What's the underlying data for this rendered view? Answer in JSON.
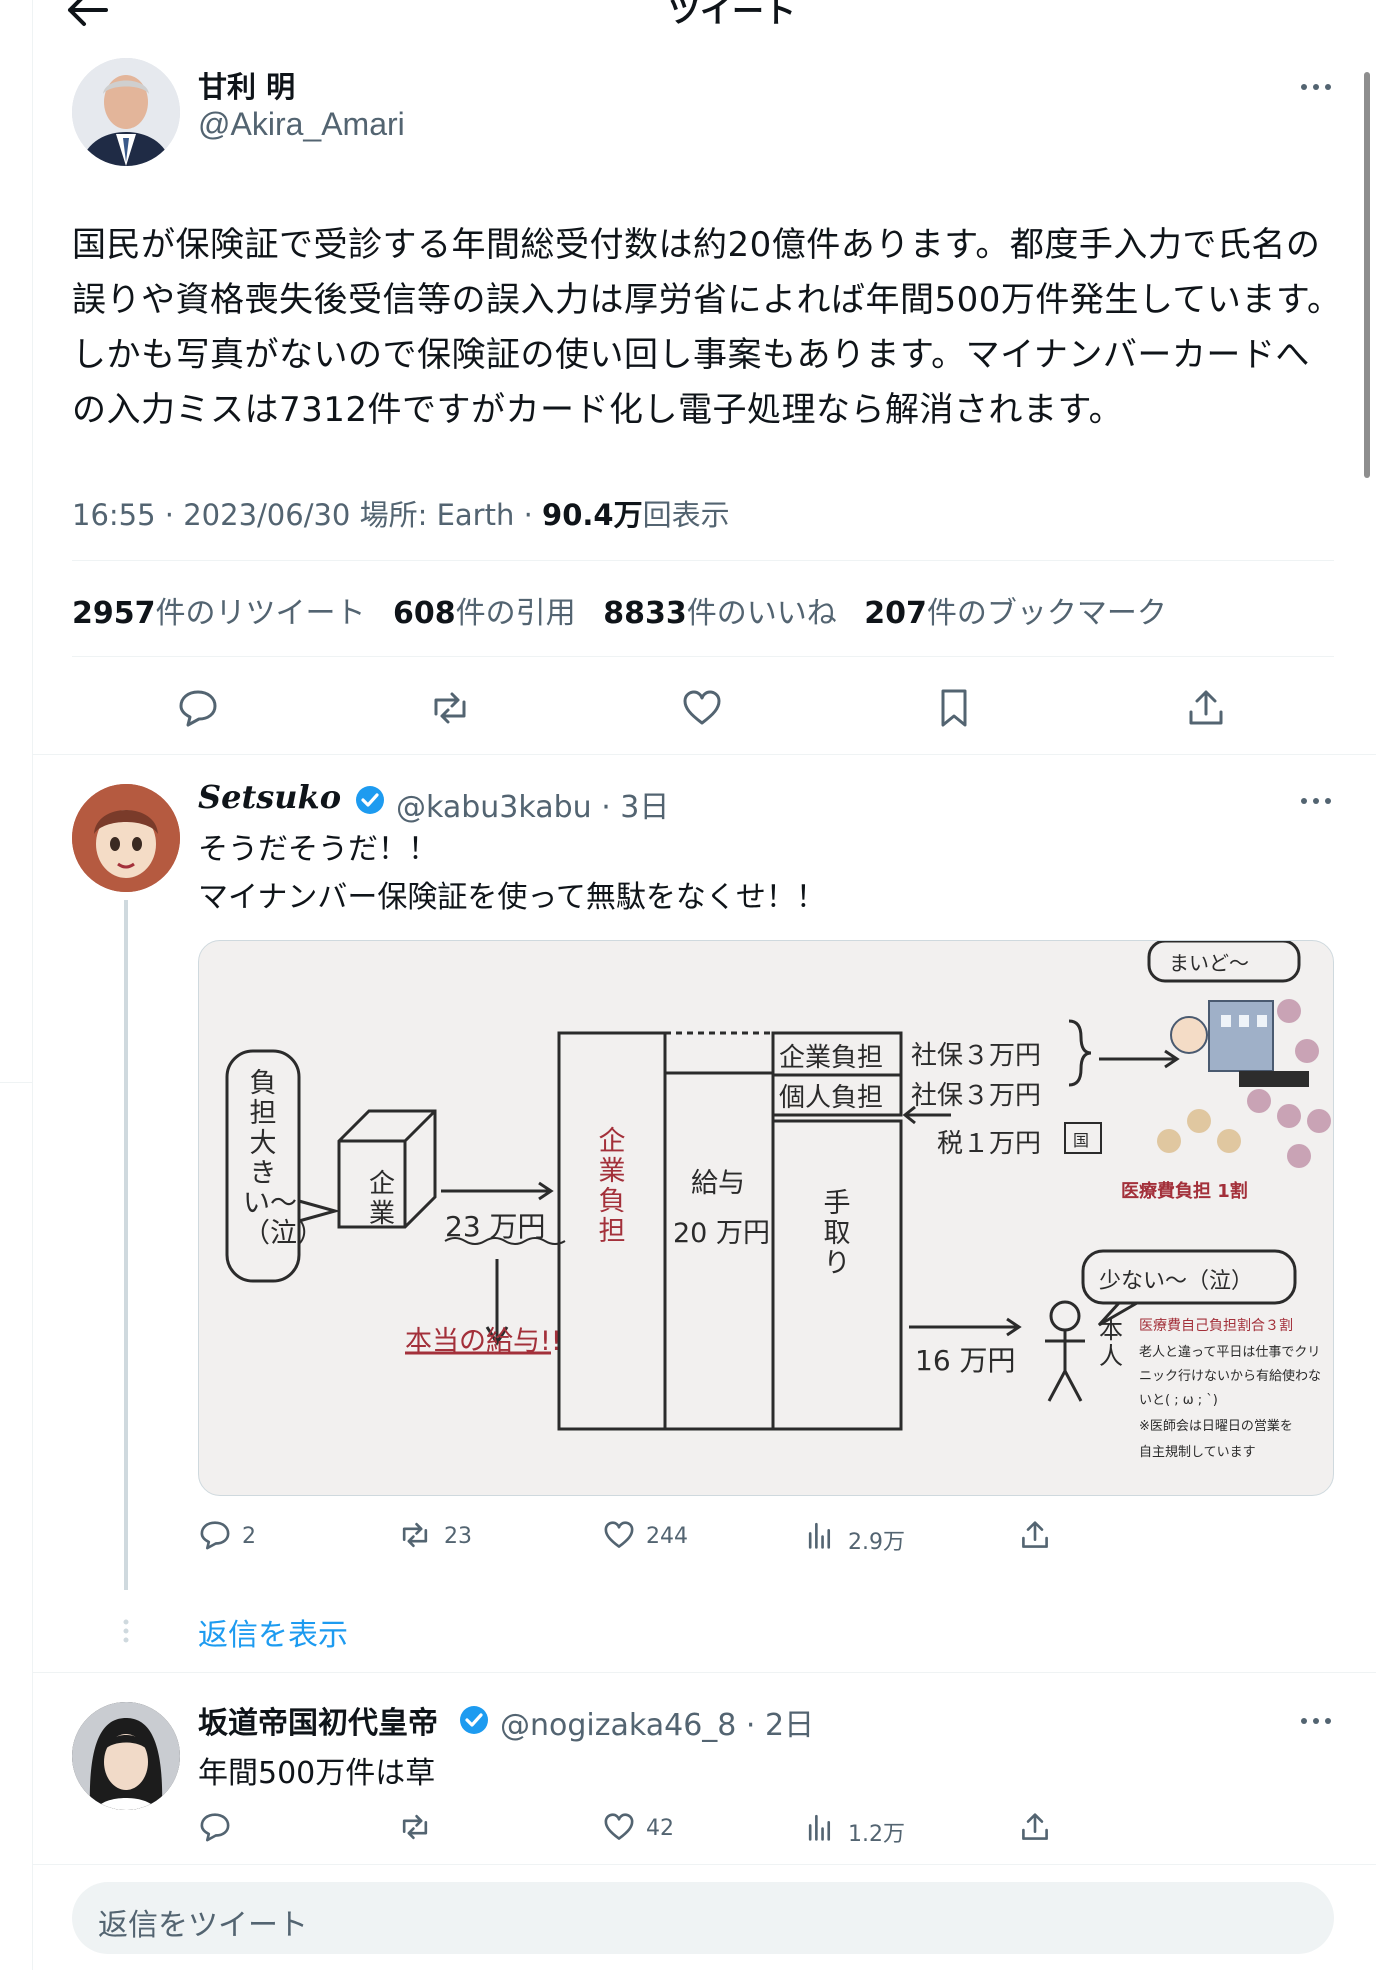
{
  "header": {
    "title": "ツイート"
  },
  "main_tweet": {
    "author_name": "甘利 明",
    "author_handle": "@Akira_Amari",
    "text": "国民が保険証で受診する年間総受付数は約20億件あります。都度手入力で氏名の誤りや資格喪失後受信等の誤入力は厚労省によれば年間500万件発生しています。しかも写真がないので保険証の使い回し事案もあります。マイナンバーカードへの入力ミスは7312件ですがカード化し電子処理なら解消されます。",
    "meta_prefix": "16:55 · 2023/06/30 場所: Earth · ",
    "views_count": "90.4万",
    "views_label": "回表示",
    "stats": {
      "retweets_num": "2957",
      "retweets_label": "件のリツイート",
      "quotes_num": "608",
      "quotes_label": "件の引用",
      "likes_num": "8833",
      "likes_label": "件のいいね",
      "bookmarks_num": "207",
      "bookmarks_label": "件のブックマーク"
    },
    "icons": [
      "reply-icon",
      "retweet-icon",
      "like-icon",
      "bookmark-icon",
      "share-icon"
    ]
  },
  "reply1": {
    "author_name": "Setsuko",
    "handle_time": "@kabu3kabu · 3日",
    "line1": "そうだそうだ！！",
    "line2": "マイナンバー保険証を使って無駄をなくせ！！",
    "media": {
      "bubble_left": "負担大きい〜（泣）",
      "company": "企業",
      "amount_23": "23 万円",
      "real_salary": "本当の給与!!",
      "company_burden": "企業負担",
      "salary_label": "給与",
      "salary_amount": "20 万円",
      "takehome": "手取り",
      "corp_burden_box": "企業負担",
      "indiv_burden_box": "個人負担",
      "shaho1": "社保３万円",
      "shaho2": "社保３万円",
      "tax": "税１万円",
      "koku": "国",
      "amount_16": "16 万円",
      "honnin": "本人",
      "maido": "まいど〜",
      "medical_1": "医療費負担 1割",
      "sukunai": "少ない〜（泣）",
      "medical_3": "医療費自己負担割合３割",
      "note1": "老人と違って平日は仕事でクリ",
      "note2": "ニック行けないから有給使わな",
      "note3": "いと( ; ω ; `)",
      "note4": "※医師会は日曜日の営業を",
      "note5": "自主規制しています"
    },
    "actions": {
      "replies": "2",
      "retweets": "23",
      "likes": "244",
      "views": "2.9万"
    },
    "show_replies": "返信を表示"
  },
  "reply2": {
    "author_name": "坂道帝国初代皇帝",
    "handle_time": "@nogizaka46_8 · 2日",
    "text": "年間500万件は草",
    "actions": {
      "likes": "42",
      "views": "1.2万"
    }
  },
  "compose": {
    "placeholder": "返信をツイート"
  },
  "colors": {
    "accent": "#1d9bf0",
    "secondary_text": "#536471",
    "border": "#eff3f4"
  }
}
